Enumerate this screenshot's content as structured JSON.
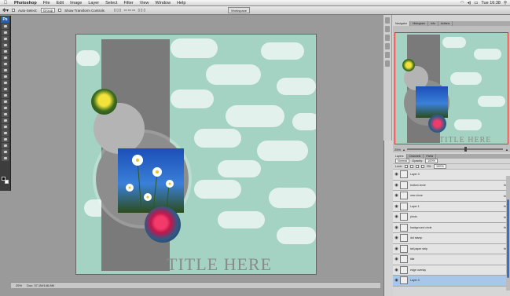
{
  "menubar": {
    "apple": "",
    "app": "Photoshop",
    "items": [
      "File",
      "Edit",
      "Image",
      "Layer",
      "Select",
      "Filter",
      "View",
      "Window",
      "Help"
    ],
    "clock": "Tue 16:38"
  },
  "options": {
    "auto_select_label": "Auto-Select:",
    "auto_select_value": "Group",
    "transform_label": "Show Transform Controls",
    "workspace": "Workspace"
  },
  "document": {
    "title_text": "TITLE HERE"
  },
  "statusbar": {
    "zoom": "25%",
    "doc_info": "Doc: 37.1M/146.8M"
  },
  "navigator": {
    "tabs": [
      "Navigator",
      "Histogram",
      "Info",
      "Actions"
    ],
    "zoom": "25%"
  },
  "layers": {
    "tabs": [
      "Layers",
      "Channels",
      "Paths"
    ],
    "blend_mode": "Normal",
    "opacity_label": "Opacity:",
    "opacity": "100%",
    "lock_label": "Lock:",
    "fill_label": "Fill:",
    "fill": "100%",
    "rows": [
      {
        "name": "Layer 3",
        "fx": false,
        "active": false
      },
      {
        "name": "bottom circle",
        "fx": true,
        "active": false
      },
      {
        "name": "new clone",
        "fx": true,
        "active": false
      },
      {
        "name": "Layer 1",
        "fx": true,
        "active": false
      },
      {
        "name": "photo",
        "fx": true,
        "active": false
      },
      {
        "name": "background circle",
        "fx": true,
        "active": false
      },
      {
        "name": "dot stamp",
        "fx": false,
        "active": false
      },
      {
        "name": "tall paper strip",
        "fx": true,
        "active": false
      },
      {
        "name": "title",
        "fx": false,
        "active": false
      },
      {
        "name": "edge overlay",
        "fx": false,
        "active": false
      },
      {
        "name": "Layer 0",
        "fx": false,
        "active": true
      }
    ]
  }
}
